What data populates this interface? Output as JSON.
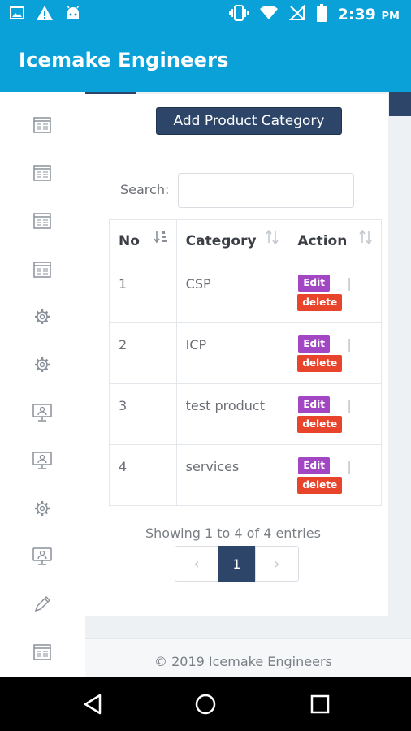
{
  "status_bar": {
    "time": "2:39",
    "ampm": "PM",
    "icons": [
      "image-icon",
      "alert-icon",
      "android-icon",
      "vibrate-icon",
      "wifi-icon",
      "no-signal-icon",
      "battery-icon"
    ]
  },
  "app": {
    "title": "Icemake Engineers"
  },
  "sidebar": {
    "icons": [
      "table-icon",
      "table-icon",
      "table-icon",
      "table-icon",
      "gear-icon",
      "gear-icon",
      "monitor-icon",
      "monitor-icon",
      "gear-icon",
      "monitor-icon",
      "pencil-icon",
      "table-icon"
    ]
  },
  "main": {
    "add_button_label": "Add Product Category",
    "search_label": "Search:",
    "search_value": "",
    "columns": [
      "No",
      "Category",
      "Action"
    ],
    "rows": [
      {
        "no": "1",
        "category": "CSP",
        "edit": "Edit",
        "delete": "delete"
      },
      {
        "no": "2",
        "category": "ICP",
        "edit": "Edit",
        "delete": "delete"
      },
      {
        "no": "3",
        "category": "test product",
        "edit": "Edit",
        "delete": "delete"
      },
      {
        "no": "4",
        "category": "services",
        "edit": "Edit",
        "delete": "delete"
      }
    ],
    "action_separator": "|",
    "showing_text": "Showing 1 to 4 of 4 entries",
    "pagination": {
      "prev": "‹",
      "current": "1",
      "next": "›"
    },
    "footer": "© 2019 Icemake Engineers"
  },
  "colors": {
    "primary": "#0aa1d9",
    "navy": "#2c4568",
    "edit": "#a346c4",
    "delete": "#e8432b"
  }
}
